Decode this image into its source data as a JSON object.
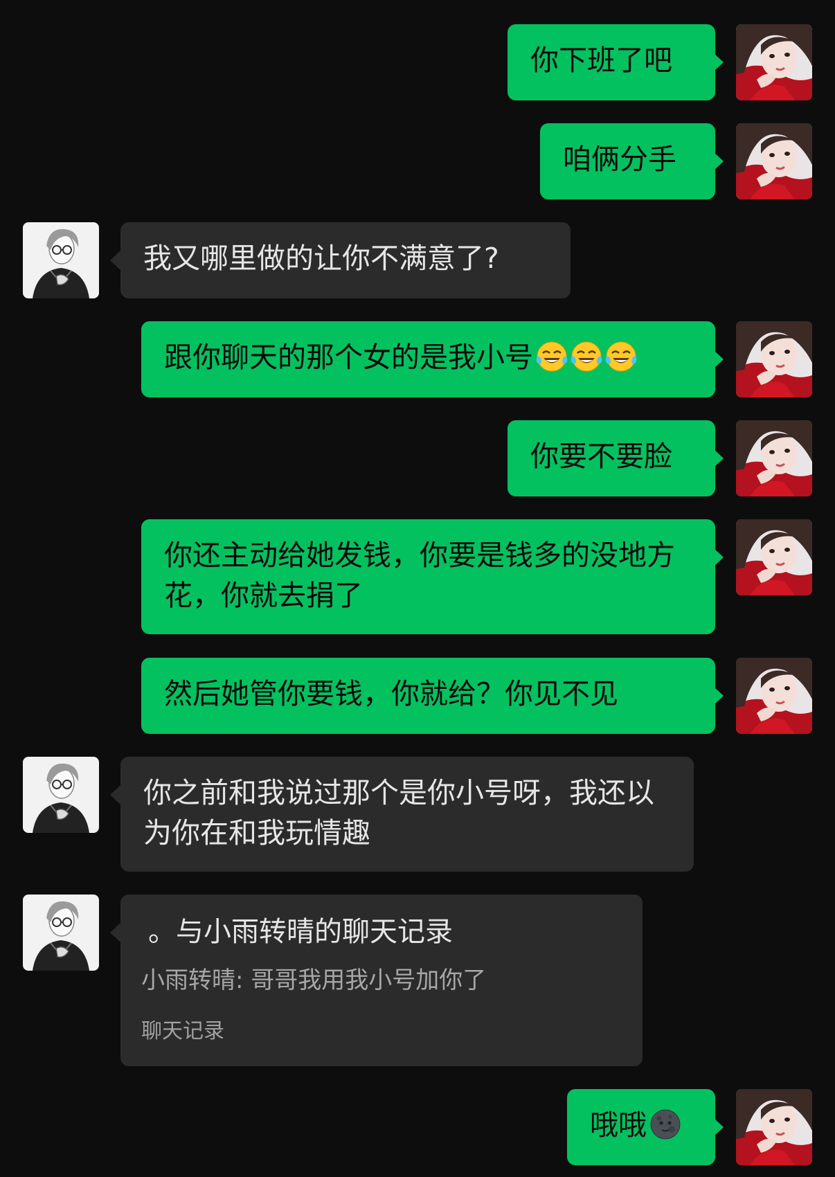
{
  "theme": {
    "background": "#0d0d0d",
    "outgoing_bubble": "#04c160",
    "incoming_bubble": "#2b2b2b"
  },
  "avatars": {
    "self": "girl-photo-avatar",
    "other": "anime-boy-sketch-avatar"
  },
  "messages": [
    {
      "dir": "out",
      "text": "你下班了吧"
    },
    {
      "dir": "out",
      "text": "咱俩分手"
    },
    {
      "dir": "in",
      "text": "我又哪里做的让你不满意了?"
    },
    {
      "dir": "out",
      "text": "跟你聊天的那个女的是我小号",
      "emoji": [
        "tears-of-joy-emoji",
        "tears-of-joy-emoji",
        "tears-of-joy-emoji"
      ]
    },
    {
      "dir": "out",
      "text": "你要不要脸"
    },
    {
      "dir": "out",
      "text": "你还主动给她发钱，你要是钱多的没地方花，你就去捐了"
    },
    {
      "dir": "out",
      "text": "然后她管你要钱，你就给？你见不见"
    },
    {
      "dir": "in",
      "text": "你之前和我说过那个是你小号呀，我还以为你在和我玩情趣"
    },
    {
      "dir": "in",
      "type": "record",
      "title": "。与小雨转晴的聊天记录",
      "line": "小雨转晴: 哥哥我用我小号加你了",
      "footer": "聊天记录"
    },
    {
      "dir": "out",
      "text": "哦哦",
      "emoji": [
        "new-moon-face-emoji"
      ]
    }
  ]
}
